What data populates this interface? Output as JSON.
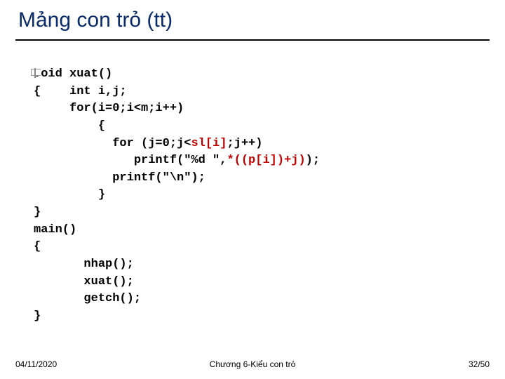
{
  "title": "Mảng con trỏ (tt)",
  "code": {
    "l1": "void xuat()",
    "l2": "{    int i,j;",
    "l3": "     for(i=0;i<m;i++)",
    "l4": "         {",
    "l5a": "           for (j=0;j<",
    "l5b": "sl[i]",
    "l5c": ";j++)",
    "l6a": "              printf(\"%d \",",
    "l6b": "*((p[i])+j)",
    "l6c": ");",
    "l7": "           printf(\"\\n\");",
    "l8": "         }",
    "l9": "}",
    "l10": "main()",
    "l11": "{",
    "l12": "       nhap();",
    "l13": "       xuat();",
    "l14": "       getch();",
    "l15": "}"
  },
  "footer": {
    "date": "04/11/2020",
    "chapter": "Chương 6-Kiểu con trỏ",
    "page": "32/50"
  }
}
